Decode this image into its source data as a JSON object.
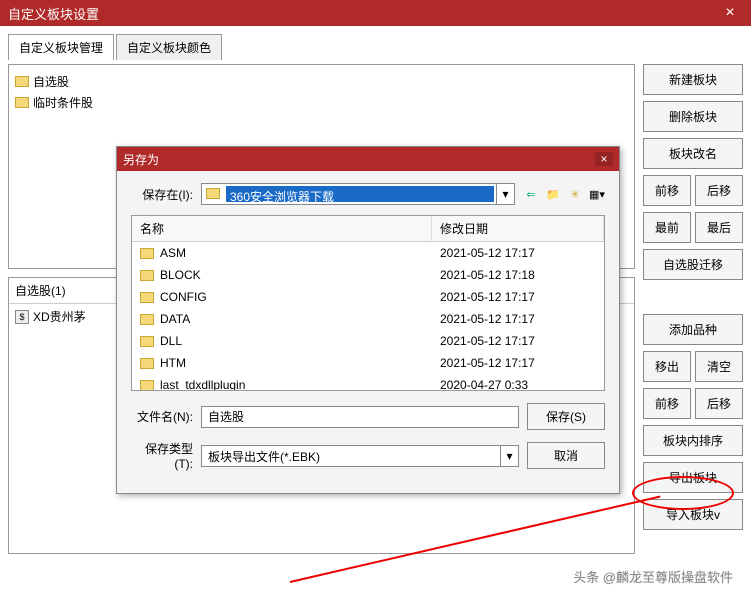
{
  "window": {
    "title": "自定义板块设置",
    "close": "×"
  },
  "tabs": [
    {
      "label": "自定义板块管理",
      "active": true
    },
    {
      "label": "自定义板块颜色",
      "active": false
    }
  ],
  "tree": [
    {
      "label": "自选股"
    },
    {
      "label": "临时条件股"
    }
  ],
  "stock_list": {
    "header": "自选股(1)",
    "items": [
      {
        "icon": "$",
        "label": "XD贵州茅"
      }
    ]
  },
  "buttons_top": {
    "new": "新建板块",
    "delete": "删除板块",
    "rename": "板块改名",
    "fwd": "前移",
    "back": "后移",
    "first": "最前",
    "last": "最后",
    "migrate": "自选股迁移"
  },
  "buttons_bottom": {
    "add": "添加品种",
    "remove": "移出",
    "clear": "清空",
    "fwd": "前移",
    "back": "后移",
    "sort": "板块内排序",
    "export": "导出板块",
    "import": "导入板块v"
  },
  "saveas": {
    "title": "另存为",
    "close": "×",
    "savein_label": "保存在(I):",
    "location_selected": "360安全浏览器下载",
    "columns": {
      "name": "名称",
      "date": "修改日期"
    },
    "files": [
      {
        "name": "ASM",
        "date": "2021-05-12 17:17"
      },
      {
        "name": "BLOCK",
        "date": "2021-05-12 17:18"
      },
      {
        "name": "CONFIG",
        "date": "2021-05-12 17:17"
      },
      {
        "name": "DATA",
        "date": "2021-05-12 17:17"
      },
      {
        "name": "DLL",
        "date": "2021-05-12 17:17"
      },
      {
        "name": "HTM",
        "date": "2021-05-12 17:17"
      },
      {
        "name": "last_tdxdllplugin",
        "date": "2020-04-27 0:33"
      }
    ],
    "filename_label": "文件名(N):",
    "filename_value": "自选股",
    "filetype_label": "保存类型(T):",
    "filetype_value": "板块导出文件(*.EBK)",
    "save_btn": "保存(S)",
    "cancel_btn": "取消"
  },
  "footer": "头条 @麟龙至尊版操盘软件"
}
